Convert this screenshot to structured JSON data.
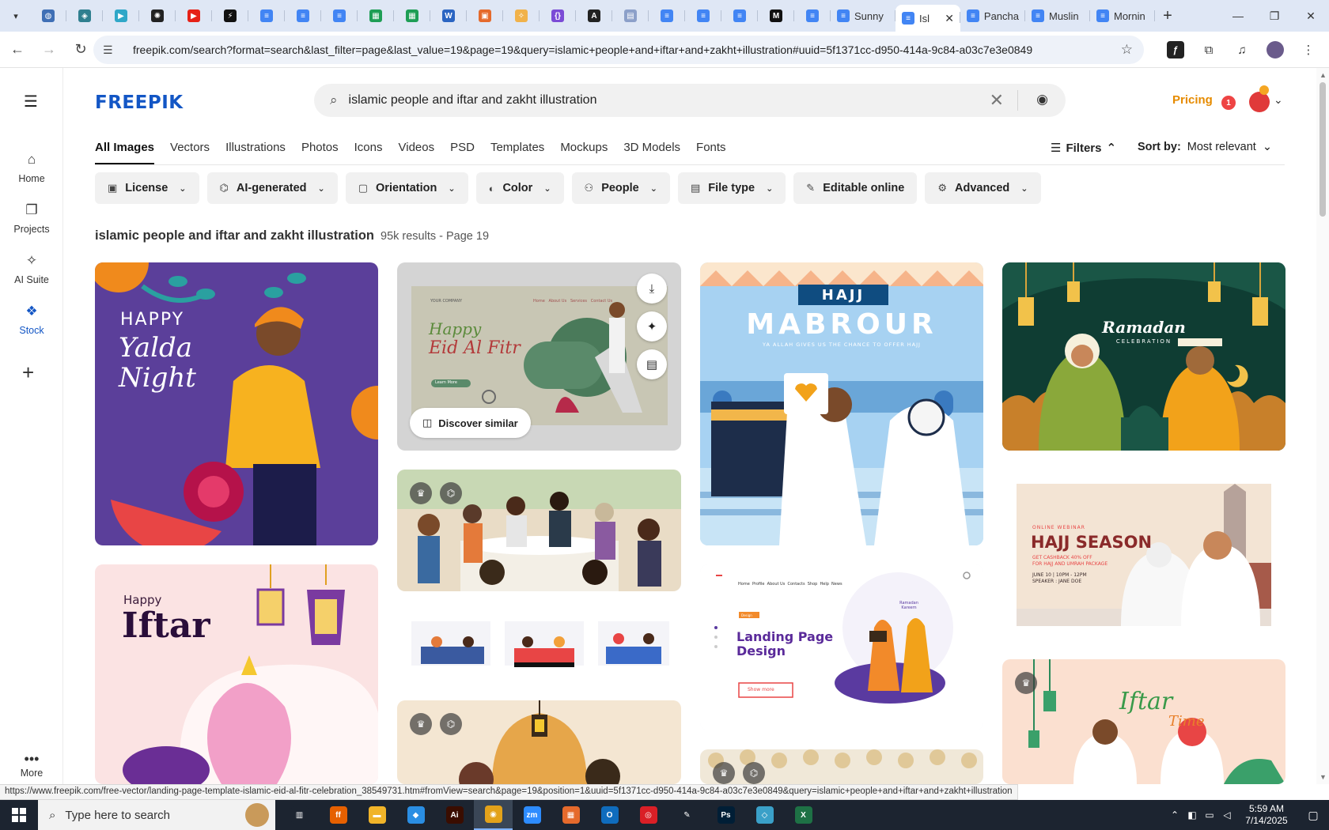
{
  "browser": {
    "tabs": [
      {
        "title": "",
        "icon": "earth-icon",
        "color": "#3f6fb5"
      },
      {
        "title": "",
        "icon": "shield-icon",
        "color": "#2f7f8f"
      },
      {
        "title": "",
        "icon": "play-icon",
        "color": "#2fa7c8"
      },
      {
        "title": "",
        "icon": "openai-icon",
        "color": "#222222"
      },
      {
        "title": "",
        "icon": "youtube-icon",
        "color": "#e62117"
      },
      {
        "title": "",
        "icon": "bolt-icon",
        "color": "#111111"
      },
      {
        "title": "",
        "icon": "docs-icon",
        "color": "#4285f4"
      },
      {
        "title": "",
        "icon": "docs-icon",
        "color": "#4285f4"
      },
      {
        "title": "",
        "icon": "docs-icon",
        "color": "#4285f4"
      },
      {
        "title": "",
        "icon": "sheets-icon",
        "color": "#1e9e55"
      },
      {
        "title": "",
        "icon": "sheets-icon",
        "color": "#1e9e55"
      },
      {
        "title": "",
        "icon": "word-icon",
        "color": "#2b65c2"
      },
      {
        "title": "",
        "icon": "grid-icon",
        "color": "#e56a2c"
      },
      {
        "title": "",
        "icon": "sparkle-icon",
        "color": "#f1b24a"
      },
      {
        "title": "",
        "icon": "braces-icon",
        "color": "#7b4bd6"
      },
      {
        "title": "",
        "icon": "artstation-icon",
        "color": "#222222"
      },
      {
        "title": "",
        "icon": "table-icon",
        "color": "#8ca0c9"
      },
      {
        "title": "",
        "icon": "docs-icon",
        "color": "#4285f4"
      },
      {
        "title": "",
        "icon": "docs-icon",
        "color": "#4285f4"
      },
      {
        "title": "",
        "icon": "docs-icon",
        "color": "#4285f4"
      },
      {
        "title": "",
        "icon": "medium-icon",
        "color": "#111111"
      },
      {
        "title": "",
        "icon": "docs-icon",
        "color": "#4285f4"
      }
    ],
    "titled_tabs": [
      {
        "title": "Sunny",
        "active": false
      },
      {
        "title": "Isl",
        "active": true
      },
      {
        "title": "Pancha",
        "active": false
      },
      {
        "title": "Muslin",
        "active": false
      },
      {
        "title": "Mornin",
        "active": false
      }
    ],
    "new_tab": "+",
    "url": "freepik.com/search?format=search&last_filter=page&last_value=19&page=19&query=islamic+people+and+iftar+and+zakht+illustration#uuid=5f1371cc-d950-414a-9c84-a03c7e3e0849"
  },
  "rail": {
    "items": [
      {
        "label": "Home",
        "icon": "⌂",
        "active": false
      },
      {
        "label": "Projects",
        "icon": "❐",
        "active": false
      },
      {
        "label": "AI Suite",
        "icon": "✧",
        "active": false
      },
      {
        "label": "Stock",
        "icon": "❖",
        "active": true
      }
    ],
    "more_label": "More"
  },
  "header": {
    "logo": "FREEPIK",
    "search_value": "islamic people and iftar and zakht illustration",
    "pricing": "Pricing",
    "notification_count": "1"
  },
  "categories": [
    "All Images",
    "Vectors",
    "Illustrations",
    "Photos",
    "Icons",
    "Videos",
    "PSD",
    "Templates",
    "Mockups",
    "3D Models",
    "Fonts"
  ],
  "filters_label": "Filters",
  "sort": {
    "label": "Sort by:",
    "value": "Most relevant"
  },
  "chips": [
    {
      "label": "License",
      "icon": "▣"
    },
    {
      "label": "AI-generated",
      "icon": "⌬"
    },
    {
      "label": "Orientation",
      "icon": "▢"
    },
    {
      "label": "Color",
      "icon": "◐"
    },
    {
      "label": "People",
      "icon": "⚇"
    },
    {
      "label": "File type",
      "icon": "▤"
    },
    {
      "label": "Editable online",
      "icon": "✎"
    },
    {
      "label": "Advanced",
      "icon": "⚙"
    }
  ],
  "results": {
    "query": "islamic people and iftar and zakht illustration",
    "count": "95k results - Page 19"
  },
  "cards": {
    "yalda": {
      "line1": "HAPPY",
      "line2": "Yalda",
      "line3": "Night"
    },
    "eid": {
      "line1": "Happy",
      "line2": "Eid Al Fitr",
      "nav": "Home   About Us   Services   Contact Us",
      "brand": "YOUR COMPANY",
      "cta": "Learn More"
    },
    "discover_label": "Discover similar",
    "hajj": {
      "tag": "HAJJ",
      "title": "MABROUR",
      "sub": "YA ALLAH GIVES US THE CHANCE TO OFFER HAJJ"
    },
    "ramadan": {
      "title": "Ramadan",
      "sub": "CELEBRATION"
    },
    "iftar": {
      "line1": "Happy",
      "line2": "Iftar"
    },
    "landing": {
      "title1": "Landing Page",
      "title2": "Design",
      "nav": "Home  Profile  About Us  Contacts  Shop  Help  News",
      "tag": "Design",
      "cta": "Show more",
      "bubble": "Ramadan Kareem"
    },
    "hajj_season": {
      "kicker": "ONLINE WEBINAR",
      "title": "HAJJ SEASON",
      "line1": "GET CASHBACK 40% OFF",
      "line2": "FOR HAJJ AND UMRAH PACKAGE",
      "line3": "JUNE 10 | 10PM - 12PM",
      "line4": "SPEAKER : JANE DOE"
    },
    "iftar_time": {
      "line1": "Iftar",
      "line2": "Time"
    }
  },
  "status_url": "https://www.freepik.com/free-vector/landing-page-template-islamic-eid-al-fitr-celebration_38549731.htm#fromView=search&page=19&position=1&uuid=5f1371cc-d950-414a-9c84-a03c7e3e0849&query=islamic+people+and+iftar+and+zakht+illustration",
  "taskbar": {
    "search_placeholder": "Type here to search",
    "apps": [
      {
        "name": "task-view",
        "label": "▥",
        "color": "#1c2430"
      },
      {
        "name": "firefox",
        "label": "ff",
        "color": "#e66000"
      },
      {
        "name": "file-explorer",
        "label": "▬",
        "color": "#f0b429"
      },
      {
        "name": "vscode",
        "label": "◆",
        "color": "#2a8ee3"
      },
      {
        "name": "illustrator",
        "label": "Ai",
        "color": "#3a0d00"
      },
      {
        "name": "chrome",
        "label": "◉",
        "color": "#e3a21a"
      },
      {
        "name": "zoom",
        "label": "zm",
        "color": "#2d8cff"
      },
      {
        "name": "app-grid",
        "label": "▦",
        "color": "#e56a2c"
      },
      {
        "name": "outlook",
        "label": "O",
        "color": "#0f6cbd"
      },
      {
        "name": "creative-cloud",
        "label": "◎",
        "color": "#da1f26"
      },
      {
        "name": "pen-tool",
        "label": "✎",
        "color": "#1c2430"
      },
      {
        "name": "photoshop",
        "label": "Ps",
        "color": "#001e36"
      },
      {
        "name": "crystal",
        "label": "◇",
        "color": "#3aa0c8"
      },
      {
        "name": "excel",
        "label": "X",
        "color": "#1e7145"
      }
    ],
    "time": "5:59 AM",
    "date": "7/14/2025"
  }
}
